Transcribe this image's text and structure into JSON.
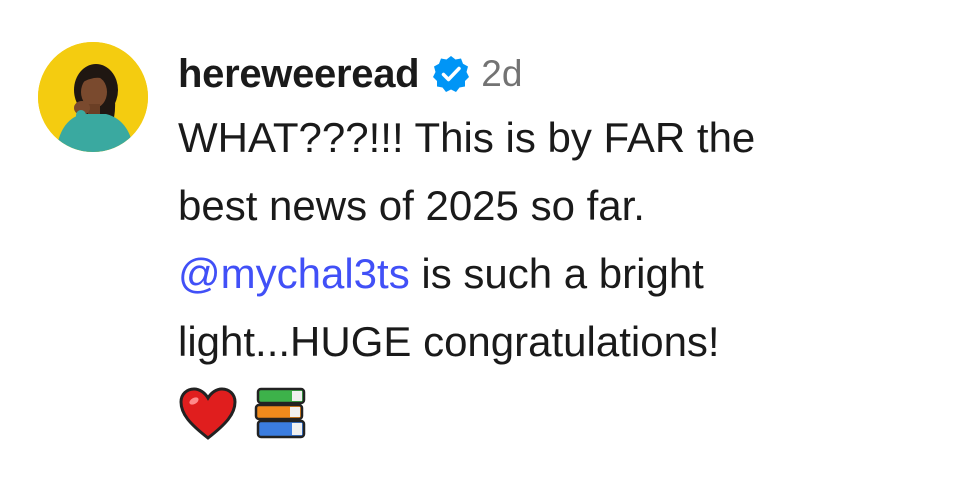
{
  "comment": {
    "username": "hereweeread",
    "verified": true,
    "timestamp": "2d",
    "text": {
      "line1": "WHAT???!!! This is by FAR the",
      "line2": "best news of 2025 so far.",
      "mention": "@mychal3ts",
      "line3_rest": " is such a bright",
      "line4": "light...HUGE congratulations!"
    },
    "emojis": [
      "red-heart",
      "books"
    ]
  },
  "colors": {
    "avatar_bg": "#f4cc10",
    "mention": "#4150f7",
    "verified_badge": "#0095f6",
    "timestamp": "#737373"
  },
  "icons": {
    "verified": "verified-badge-icon",
    "avatar": "user-avatar"
  }
}
